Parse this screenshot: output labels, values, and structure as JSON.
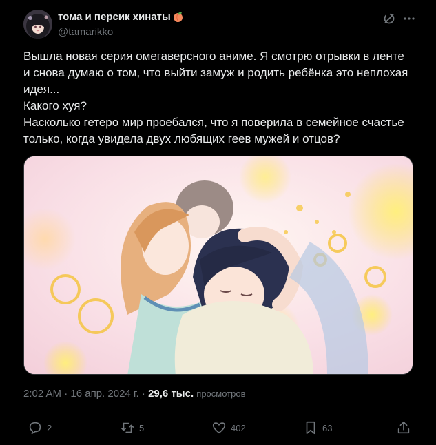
{
  "author": {
    "display_name": "тома и персик хинаты",
    "handle": "@tamarikko",
    "avatar": "avatar-image",
    "name_emoji": "peach-emoji"
  },
  "header_icons": [
    "grok-icon",
    "more-icon"
  ],
  "tweet": {
    "paragraphs": [
      "Вышла новая серия омегаверсного аниме. Я смотрю отрывки в ленте и снова думаю о том, что выйти замуж и родить ребёнка это неплохая идея...",
      "Какого хуя?",
      "Насколько гетеро мир проебался, что я поверила в семейное счастье только, когда увидела двух любящих геев мужей и отцов?"
    ]
  },
  "media": {
    "kind": "anime-screenshot-illustration"
  },
  "meta": {
    "time": "2:02 AM",
    "separator": "·",
    "date": "16 апр. 2024 г.",
    "views_count": "29,6 тыс.",
    "views_label": "просмотров"
  },
  "actions": {
    "reply_count": "2",
    "repost_count": "5",
    "like_count": "402",
    "bookmark_count": "63"
  },
  "colors": {
    "background": "#000000",
    "text": "#e7e9ea",
    "secondary": "#71767b",
    "border": "#2f3336"
  }
}
